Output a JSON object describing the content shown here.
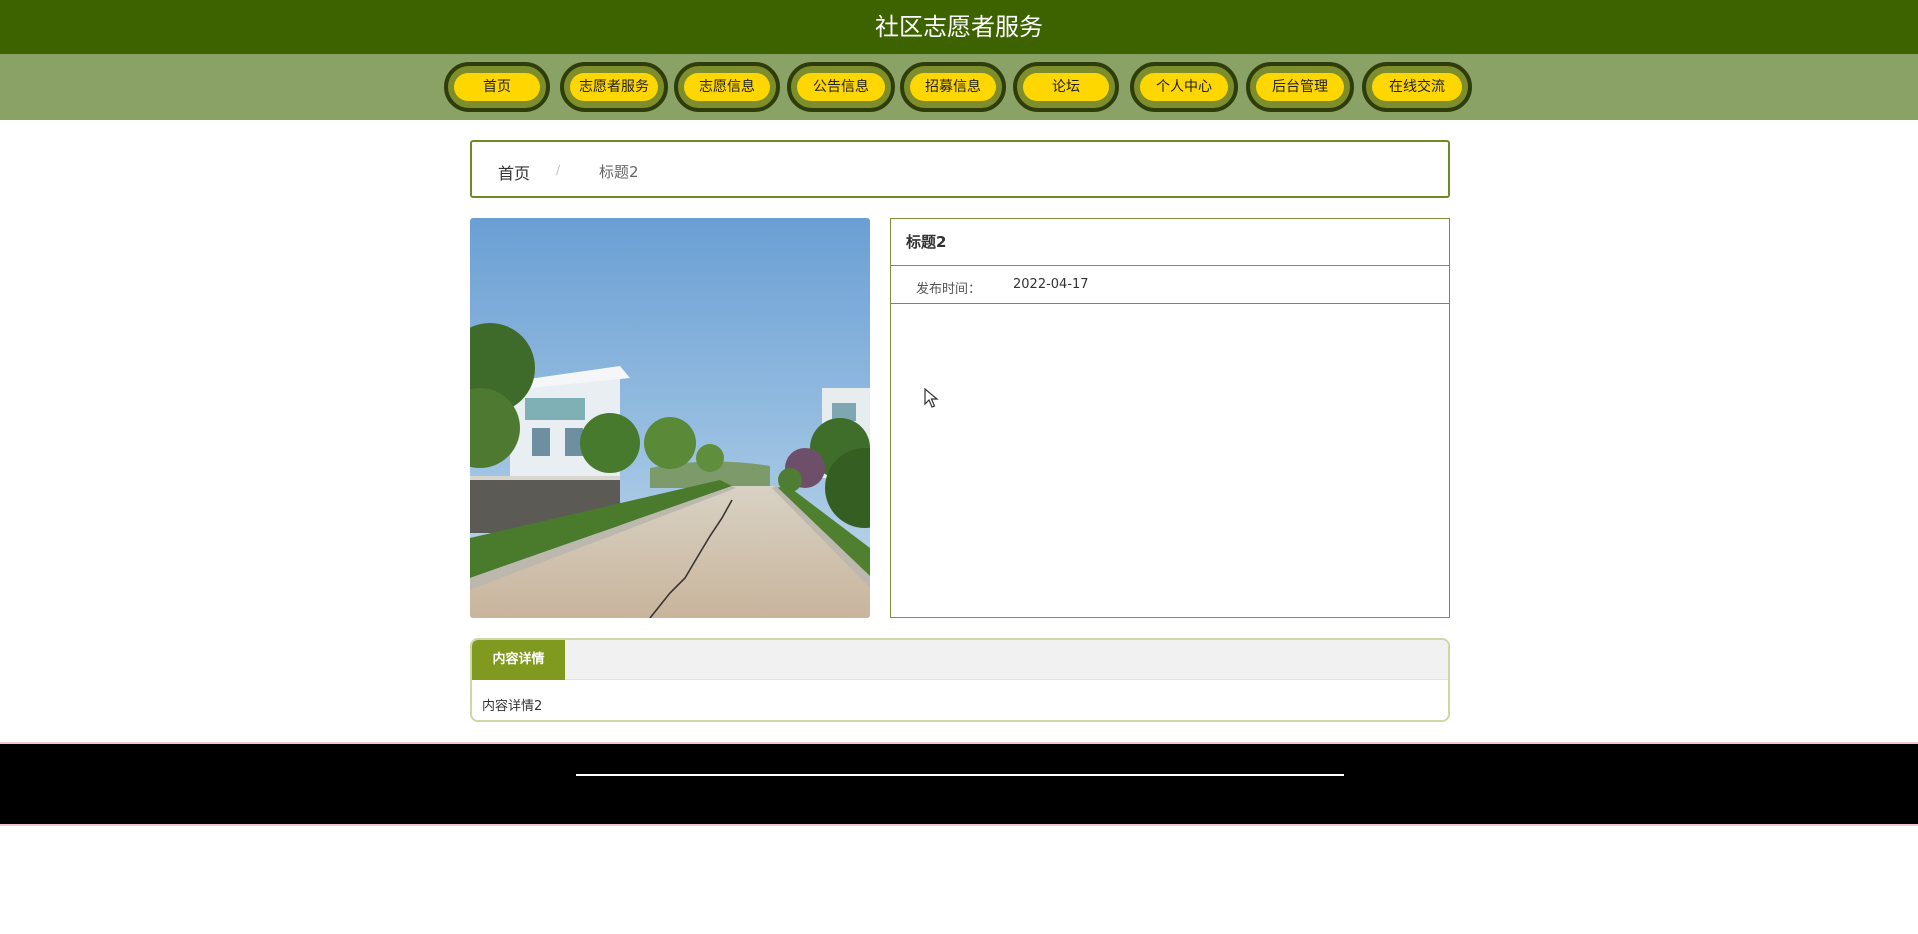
{
  "site": {
    "title": "社区志愿者服务"
  },
  "nav": {
    "items": [
      {
        "label": "首页"
      },
      {
        "label": "志愿者服务"
      },
      {
        "label": "志愿信息"
      },
      {
        "label": "公告信息"
      },
      {
        "label": "招募信息"
      },
      {
        "label": "论坛"
      },
      {
        "label": "个人中心"
      },
      {
        "label": "后台管理"
      },
      {
        "label": "在线交流"
      }
    ]
  },
  "breadcrumb": {
    "home": "首页",
    "separator": "/",
    "current": "标题2"
  },
  "article": {
    "title": "标题2",
    "publish_label": "发布时间：",
    "publish_date": "2022-04-17"
  },
  "detail": {
    "tab_label": "内容详情",
    "content": "内容详情2"
  },
  "colors": {
    "header": "#3d6300",
    "navbar": "#8aa266",
    "nav_pill": "#ffd700",
    "accent": "#7f9a1f",
    "footer": "#000000"
  }
}
